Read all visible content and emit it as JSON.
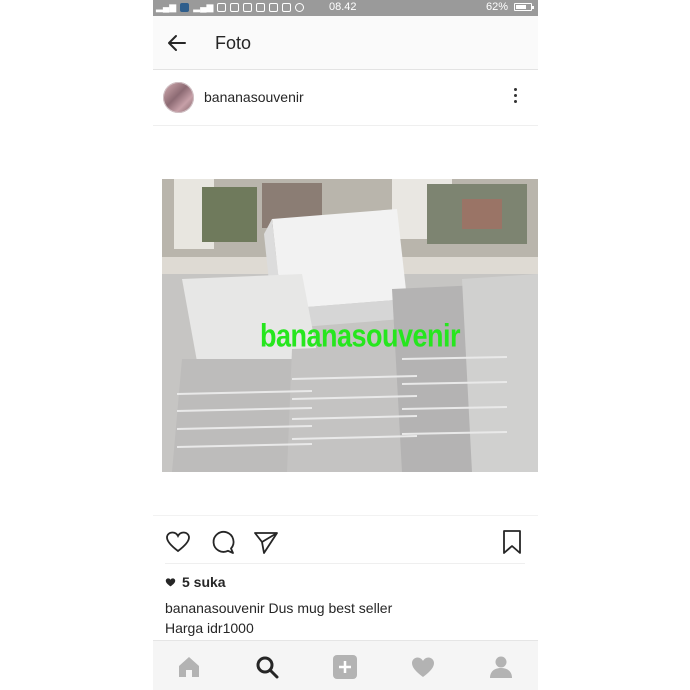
{
  "status_bar": {
    "time": "08.42",
    "battery": "62%",
    "battery_level": 0.62
  },
  "header": {
    "title": "Foto",
    "back_icon": "arrow-left-icon"
  },
  "post": {
    "username": "bananasouvenir",
    "menu_icon": "more-vertical-icon",
    "watermark": "bananasouvenir",
    "likes": "5 suka",
    "caption": {
      "username": "bananasouvenir",
      "text": "Dus mug best seller",
      "line2": "Harga idr1000"
    }
  },
  "actions": {
    "like_icon": "heart-outline-icon",
    "comment_icon": "comment-icon",
    "share_icon": "send-icon",
    "save_icon": "bookmark-icon"
  },
  "bottom_nav": {
    "items": [
      "home-icon",
      "search-icon",
      "add-icon",
      "activity-heart-icon",
      "profile-icon"
    ],
    "active": "search-icon"
  },
  "colors": {
    "status_bar": "#9a9a9a",
    "watermark": "#26e61e",
    "text": "#262626"
  }
}
